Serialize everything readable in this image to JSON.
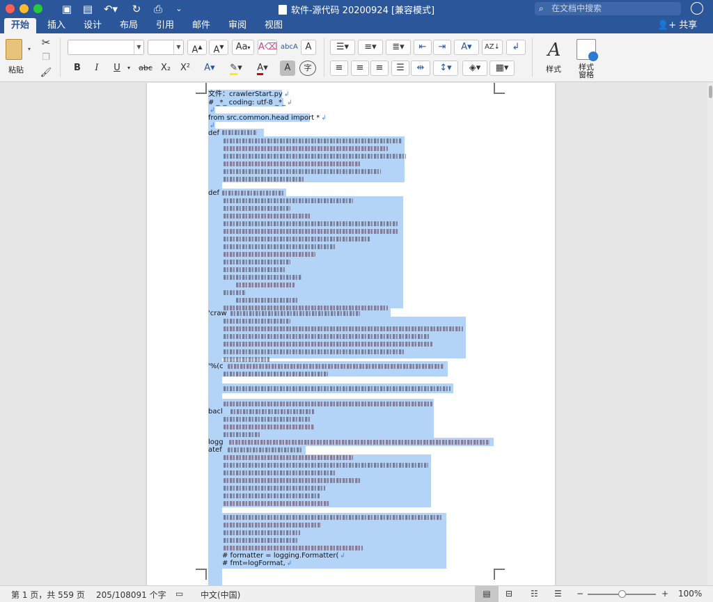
{
  "window": {
    "title": "软件-源代码 20200924 [兼容模式]",
    "search_placeholder": "在文档中搜索"
  },
  "tabs": [
    "开始",
    "插入",
    "设计",
    "布局",
    "引用",
    "邮件",
    "审阅",
    "视图"
  ],
  "active_tab": "开始",
  "share_label": "共享",
  "ribbon": {
    "paste_label": "粘贴",
    "font_name": "",
    "font_size": "",
    "styles_label": "样式",
    "styles_pane_label_1": "样式",
    "styles_pane_label_2": "窗格",
    "bold": "B",
    "italic": "I",
    "underline": "U",
    "strikethrough": "abc",
    "subscript": "X₂",
    "superscript": "X²",
    "grow_font": "A",
    "shrink_font": "A",
    "change_case": "Aa",
    "phonetic": "字",
    "char_shading": "A"
  },
  "document": {
    "line1": "文件：crawlerStart.py",
    "line2": "# _*_ coding: utf-8 _*_",
    "line3": "from src.common.head import *",
    "def1": "def",
    "def2": "def",
    "frag_craw": "'craw",
    "frag_pct": "'%(c",
    "frag_back": "bacl",
    "frag_logg": "logg",
    "frag_atef": "atef",
    "last1": "# formatter = logging.Formatter(",
    "last2": "#       fmt=logFormat,"
  },
  "status": {
    "page": "第 1 页，共 559 页",
    "words": "205/108091 个字",
    "language": "中文(中国)",
    "zoom": "100%",
    "zoom_level": 0.55
  },
  "colors": {
    "brand": "#2b579a",
    "selection": "#b3d3f7"
  }
}
